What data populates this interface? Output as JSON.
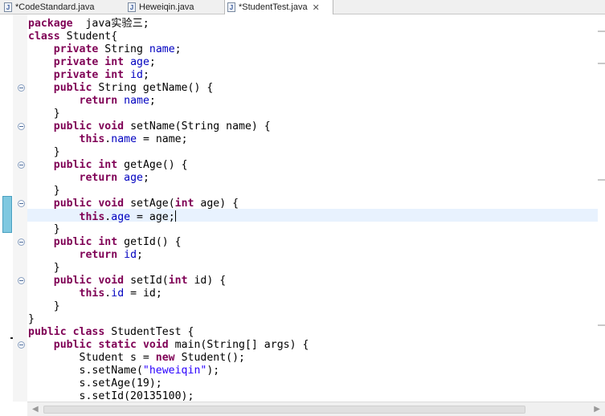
{
  "tabs": [
    {
      "icon": "java-file-icon",
      "label": "*CodeStandard.java",
      "active": false
    },
    {
      "icon": "java-file-icon",
      "label": "Heweiqin.java",
      "active": false
    },
    {
      "icon": "java-file-icon",
      "label": "*StudentTest.java",
      "active": true,
      "close": "✕"
    }
  ],
  "code_lines": [
    [
      [
        "kw",
        "package"
      ],
      [
        "",
        "  java实验三;"
      ]
    ],
    [
      [
        "kw",
        "class"
      ],
      [
        "",
        " Student{"
      ]
    ],
    [
      [
        "",
        "    "
      ],
      [
        "kw",
        "private"
      ],
      [
        "",
        " String "
      ],
      [
        "fld",
        "name"
      ],
      [
        "",
        ";"
      ]
    ],
    [
      [
        "",
        "    "
      ],
      [
        "kw",
        "private"
      ],
      [
        "",
        " "
      ],
      [
        "kw",
        "int"
      ],
      [
        "",
        " "
      ],
      [
        "fld",
        "age"
      ],
      [
        "",
        ";"
      ]
    ],
    [
      [
        "",
        "    "
      ],
      [
        "kw",
        "private"
      ],
      [
        "",
        " "
      ],
      [
        "kw",
        "int"
      ],
      [
        "",
        " "
      ],
      [
        "fld",
        "id"
      ],
      [
        "",
        ";"
      ]
    ],
    [
      [
        "",
        "    "
      ],
      [
        "kw",
        "public"
      ],
      [
        "",
        " String getName() {"
      ]
    ],
    [
      [
        "",
        "        "
      ],
      [
        "kw",
        "return"
      ],
      [
        "",
        " "
      ],
      [
        "fld",
        "name"
      ],
      [
        "",
        ";"
      ]
    ],
    [
      [
        "",
        "    }"
      ]
    ],
    [
      [
        "",
        "    "
      ],
      [
        "kw",
        "public"
      ],
      [
        "",
        " "
      ],
      [
        "kw",
        "void"
      ],
      [
        "",
        " setName(String name) {"
      ]
    ],
    [
      [
        "",
        "        "
      ],
      [
        "kw",
        "this"
      ],
      [
        "",
        "."
      ],
      [
        "fld",
        "name"
      ],
      [
        "",
        " = name;"
      ]
    ],
    [
      [
        "",
        "    }"
      ]
    ],
    [
      [
        "",
        "    "
      ],
      [
        "kw",
        "public"
      ],
      [
        "",
        " "
      ],
      [
        "kw",
        "int"
      ],
      [
        "",
        " getAge() {"
      ]
    ],
    [
      [
        "",
        "        "
      ],
      [
        "kw",
        "return"
      ],
      [
        "",
        " "
      ],
      [
        "fld",
        "age"
      ],
      [
        "",
        ";"
      ]
    ],
    [
      [
        "",
        "    }"
      ]
    ],
    [
      [
        "",
        "    "
      ],
      [
        "kw",
        "public"
      ],
      [
        "",
        " "
      ],
      [
        "kw",
        "void"
      ],
      [
        "",
        " setAge("
      ],
      [
        "kw",
        "int"
      ],
      [
        "",
        " age) {"
      ]
    ],
    [
      [
        "",
        "        "
      ],
      [
        "kw",
        "this"
      ],
      [
        "",
        "."
      ],
      [
        "fld",
        "age"
      ],
      [
        "",
        " = age;"
      ]
    ],
    [
      [
        "",
        "    }"
      ]
    ],
    [
      [
        "",
        "    "
      ],
      [
        "kw",
        "public"
      ],
      [
        "",
        " "
      ],
      [
        "kw",
        "int"
      ],
      [
        "",
        " getId() {"
      ]
    ],
    [
      [
        "",
        "        "
      ],
      [
        "kw",
        "return"
      ],
      [
        "",
        " "
      ],
      [
        "fld",
        "id"
      ],
      [
        "",
        ";"
      ]
    ],
    [
      [
        "",
        "    }"
      ]
    ],
    [
      [
        "",
        "    "
      ],
      [
        "kw",
        "public"
      ],
      [
        "",
        " "
      ],
      [
        "kw",
        "void"
      ],
      [
        "",
        " setId("
      ],
      [
        "kw",
        "int"
      ],
      [
        "",
        " id) {"
      ]
    ],
    [
      [
        "",
        "        "
      ],
      [
        "kw",
        "this"
      ],
      [
        "",
        "."
      ],
      [
        "fld",
        "id"
      ],
      [
        "",
        " = id;"
      ]
    ],
    [
      [
        "",
        "    }"
      ]
    ],
    [
      [
        "",
        "}"
      ]
    ],
    [
      [
        "kw",
        "public"
      ],
      [
        "",
        " "
      ],
      [
        "kw",
        "class"
      ],
      [
        "",
        " StudentTest {"
      ]
    ],
    [
      [
        "",
        "    "
      ],
      [
        "kw",
        "public"
      ],
      [
        "",
        " "
      ],
      [
        "kw",
        "static"
      ],
      [
        "",
        " "
      ],
      [
        "kw",
        "void"
      ],
      [
        "",
        " main(String[] args) {"
      ]
    ],
    [
      [
        "",
        "        Student s = "
      ],
      [
        "kw",
        "new"
      ],
      [
        "",
        " Student();"
      ]
    ],
    [
      [
        "",
        "        s.setName("
      ],
      [
        "str",
        "\"heweiqin\""
      ],
      [
        "",
        ");"
      ]
    ],
    [
      [
        "",
        "        s.setAge(19);"
      ]
    ],
    [
      [
        "",
        "        s.setId(20135100);"
      ]
    ]
  ],
  "cursor_line": 15,
  "fold_lines": [
    5,
    8,
    11,
    14,
    17,
    20,
    25
  ]
}
